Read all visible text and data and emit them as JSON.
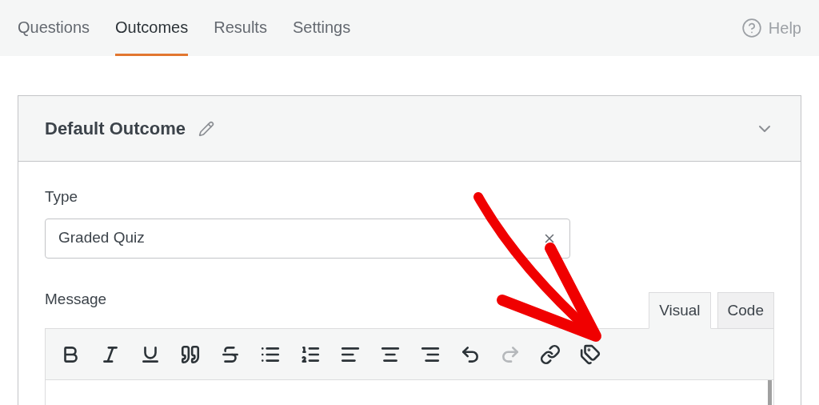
{
  "tabs": [
    {
      "label": "Questions",
      "selected": false
    },
    {
      "label": "Outcomes",
      "selected": true
    },
    {
      "label": "Results",
      "selected": false
    },
    {
      "label": "Settings",
      "selected": false
    }
  ],
  "help": {
    "label": "Help"
  },
  "outcome": {
    "title": "Default Outcome",
    "expanded": true,
    "type_label": "Type",
    "type_value": "Graded Quiz",
    "message_label": "Message",
    "editor_tabs": [
      {
        "label": "Visual",
        "selected": true
      },
      {
        "label": "Code",
        "selected": false
      }
    ],
    "toolbar": [
      {
        "kind": "bold",
        "disabled": false
      },
      {
        "kind": "italic",
        "disabled": false
      },
      {
        "kind": "underline",
        "disabled": false
      },
      {
        "kind": "quote",
        "disabled": false
      },
      {
        "kind": "strike",
        "disabled": false
      },
      {
        "kind": "bullets",
        "disabled": false
      },
      {
        "kind": "numbers",
        "disabled": false
      },
      {
        "kind": "align-left",
        "disabled": false
      },
      {
        "kind": "align-center",
        "disabled": false
      },
      {
        "kind": "align-right",
        "disabled": false
      },
      {
        "kind": "undo",
        "disabled": false
      },
      {
        "kind": "redo",
        "disabled": true
      },
      {
        "kind": "link",
        "disabled": false
      },
      {
        "kind": "tags",
        "disabled": false
      }
    ]
  }
}
